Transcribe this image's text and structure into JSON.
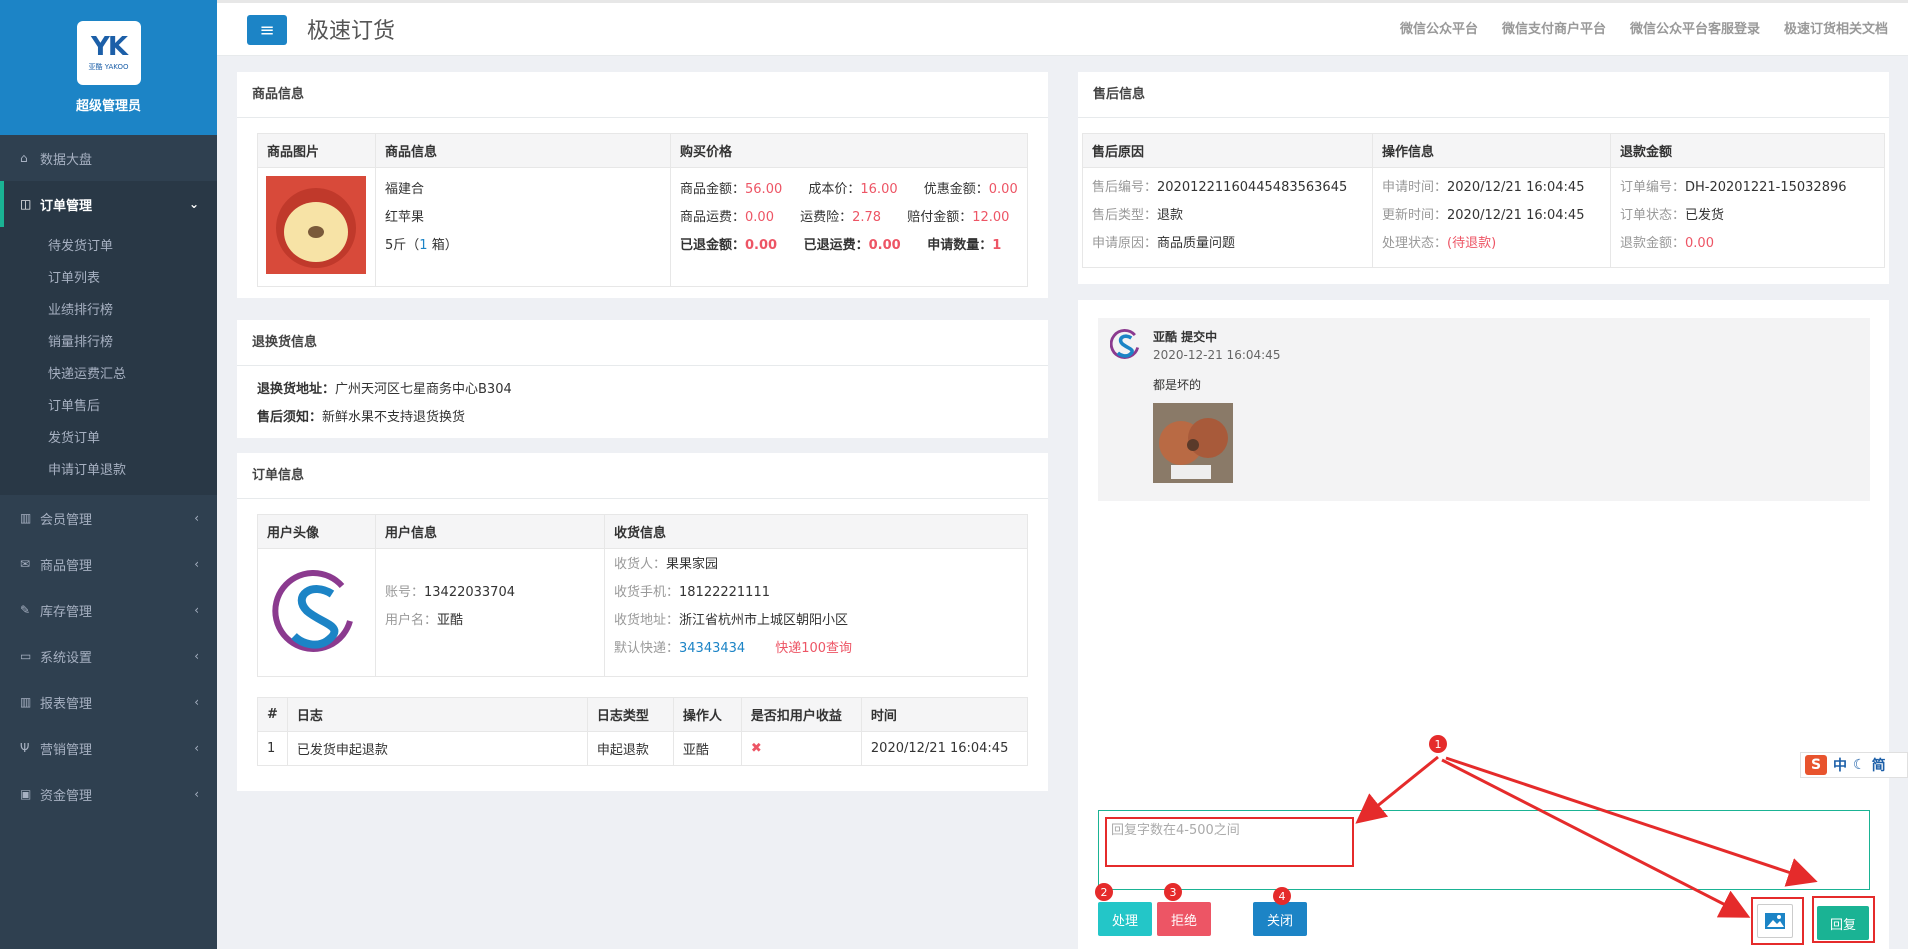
{
  "sidebar": {
    "brand_mark": "YK",
    "brand_sub": "亚酷 YAKOO",
    "admin_name": "超级管理员",
    "items": [
      {
        "label": "数据大盘",
        "icon": "home-icon"
      },
      {
        "label": "订单管理",
        "icon": "columns-icon"
      },
      {
        "label": "会员管理",
        "icon": "bar-chart-icon"
      },
      {
        "label": "商品管理",
        "icon": "envelope-icon"
      },
      {
        "label": "库存管理",
        "icon": "edit-icon"
      },
      {
        "label": "系统设置",
        "icon": "desktop-icon"
      },
      {
        "label": "报表管理",
        "icon": "bar-chart-icon"
      },
      {
        "label": "营销管理",
        "icon": "cutlery-icon"
      },
      {
        "label": "资金管理",
        "icon": "money-icon"
      }
    ],
    "order_sub": [
      "待发货订单",
      "订单列表",
      "业绩排行榜",
      "销量排行榜",
      "快递运费汇总",
      "订单售后",
      "发货订单",
      "申请订单退款"
    ]
  },
  "topbar": {
    "title": "极速订货",
    "links": [
      "微信公众平台",
      "微信支付商户平台",
      "微信公众平台客服登录",
      "极速订货相关文档"
    ]
  },
  "product": {
    "title": "商品信息",
    "headers": [
      "商品图片",
      "商品信息",
      "购买价格"
    ],
    "name": "福建合",
    "variety": "红苹果",
    "spec": "5斤（",
    "spec_qty": "1",
    "spec_unit": " 箱）",
    "price": {
      "amount_label": "商品金额：",
      "amount": "56.00",
      "cost_label": "成本价：",
      "cost": "16.00",
      "discount_label": "优惠金额：",
      "discount": "0.00",
      "ship_label": "商品运费：",
      "ship": "0.00",
      "insure_label": "运费险：",
      "insure": "2.78",
      "comp_label": "赔付金额：",
      "comp": "12.00",
      "refunded_label": "已退金额：",
      "refunded": "0.00",
      "refship_label": "已退运费：",
      "refship": "0.00",
      "applyqty_label": "申请数量：",
      "applyqty": "1"
    }
  },
  "return_info": {
    "title": "退换货信息",
    "addr_label": "退换货地址：",
    "addr": "广州天河区七星商务中心B304",
    "notice_label": "售后须知：",
    "notice": "新鲜水果不支持退货换货"
  },
  "order": {
    "title": "订单信息",
    "headers": [
      "用户头像",
      "用户信息",
      "收货信息"
    ],
    "account_label": "账号：",
    "account": "13422033704",
    "username_label": "用户名：",
    "username": "亚酷",
    "receiver_label": "收货人：",
    "receiver": "果果家园",
    "phone_label": "收货手机：",
    "phone": "18122221111",
    "address_label": "收货地址：",
    "address": "浙江省杭州市上城区朝阳小区",
    "express_label": "默认快递：",
    "express": "34343434",
    "express_query": "快递100查询",
    "log_headers": [
      "#",
      "日志",
      "日志类型",
      "操作人",
      "是否扣用户收益",
      "时间"
    ],
    "log_row": {
      "no": "1",
      "log": "已发货申起退款",
      "type": "申起退款",
      "operator": "亚酷",
      "deduct": "✖",
      "time": "2020/12/21 16:04:45"
    }
  },
  "after_sale": {
    "title": "售后信息",
    "headers": [
      "售后原因",
      "操作信息",
      "退款金额"
    ],
    "no_label": "售后编号：",
    "no": "20201221160445483563645",
    "type_label": "售后类型：",
    "type": "退款",
    "reason_label": "申请原因：",
    "reason": "商品质量问题",
    "apply_time_label": "申请时间：",
    "apply_time": "2020/12/21 16:04:45",
    "update_time_label": "更新时间：",
    "update_time": "2020/12/21 16:04:45",
    "status_label": "处理状态：",
    "status": "(待退款)",
    "order_no_label": "订单编号：",
    "order_no": "DH-20201221-15032896",
    "order_status_label": "订单状态：",
    "order_status": "已发货",
    "refund_label": "退款金额：",
    "refund": "0.00"
  },
  "chat": {
    "sender": "亚酷 提交中",
    "time": "2020-12-21 16:04:45",
    "message": "都是坏的"
  },
  "reply": {
    "placeholder": "回复字数在4-500之间",
    "process": "处理",
    "reject": "拒绝",
    "close": "关闭",
    "send": "回复",
    "badges": [
      "1",
      "2",
      "3",
      "4"
    ]
  },
  "ime": {
    "lang": "中",
    "mode": "简"
  },
  "colors": {
    "sidebar": "#2f4050",
    "brand": "#1c84c6",
    "accent": "#1ab394",
    "danger": "#ed5565",
    "annotation": "#e52b2b"
  }
}
